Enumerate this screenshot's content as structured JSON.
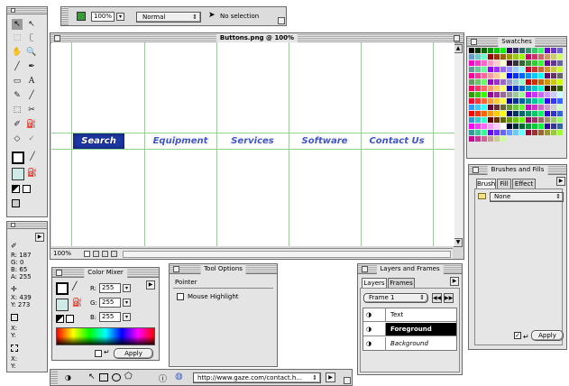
{
  "app_toolbar": {
    "zoom": "100%",
    "blend_mode": "Normal",
    "selection_status": "No selection"
  },
  "document": {
    "title": "Buttons.png @ 100%",
    "zoom_footer": "100%"
  },
  "canvas_buttons": [
    "Search",
    "Equipment",
    "Services",
    "Software",
    "Contact Us"
  ],
  "info_panel": {
    "r": "R: 187",
    "g": "G: 0",
    "b": "B: 65",
    "a": "A: 255",
    "x": "X: 439",
    "y": "Y: 273",
    "x2": "X:",
    "y2": "Y:",
    "x3": "X:",
    "y3": "Y:"
  },
  "color_mixer": {
    "title": "Color Mixer",
    "r_label": "R:",
    "r_value": "255",
    "g_label": "G:",
    "g_value": "255",
    "b_label": "B:",
    "b_value": "255",
    "apply": "Apply"
  },
  "tool_options": {
    "title": "Tool Options",
    "tool": "Pointer",
    "checkbox_label": "Mouse Highlight"
  },
  "layers_frames": {
    "title": "Layers and Frames",
    "tab_layers": "Layers",
    "tab_frames": "Frames",
    "frame": "Frame 1",
    "layers": [
      "Text",
      "Foreground",
      "Background"
    ]
  },
  "swatches": {
    "title": "Swatches"
  },
  "brushes": {
    "title": "Brushes and Fills",
    "tabs": [
      "Brush",
      "Fill",
      "Effect"
    ],
    "brush": "None",
    "apply": "Apply"
  },
  "bottom_bar": {
    "url": "http://www.gaze.com/contact.h..."
  },
  "colors": {
    "button_fill": "#3f55c4",
    "button_selected": "#1f3aa8",
    "guides": "#8fd38f",
    "selected_layer": "#000000"
  }
}
